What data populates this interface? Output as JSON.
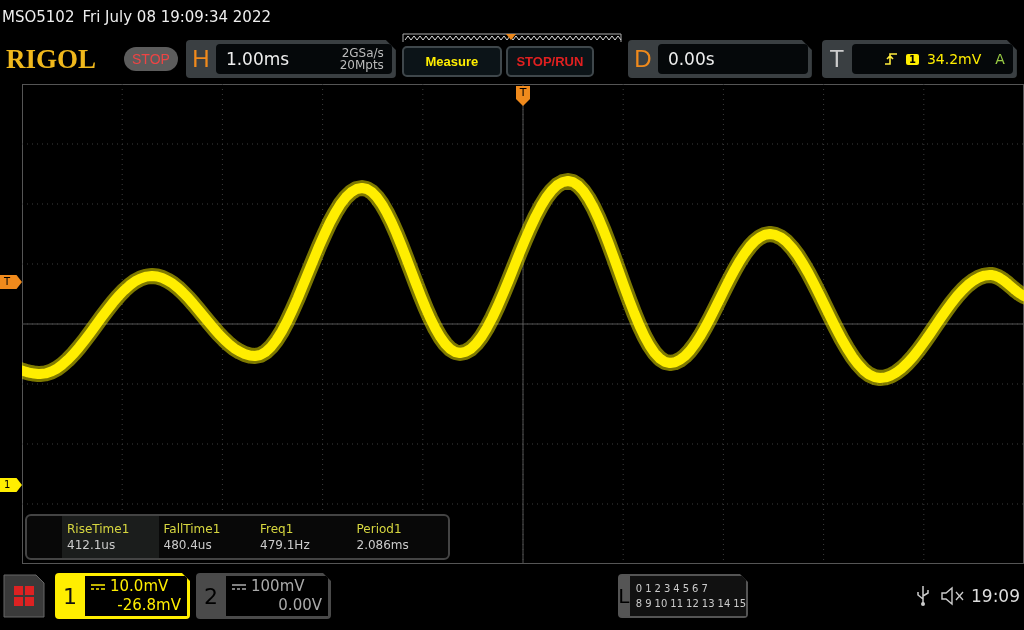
{
  "title_bar": {
    "model": "MSO5102",
    "datetime": "Fri July 08 19:09:34 2022"
  },
  "header": {
    "logo": "RIGOL",
    "run_state": "STOP",
    "horizontal": {
      "label": "H",
      "timebase": "1.00ms",
      "sample_rate": "2GSa/s",
      "memory_depth": "20Mpts"
    },
    "buttons": [
      "Measure",
      "STOP/RUN"
    ],
    "delay": {
      "label": "D",
      "value": "0.00s"
    },
    "trigger": {
      "label": "T",
      "source": "1",
      "level": "34.2mV",
      "mode": "A"
    }
  },
  "grid": {
    "trigger_position_marker": "T",
    "trigger_level_marker": "T",
    "channel_marker": "1"
  },
  "measurements": [
    {
      "name": "RiseTime1",
      "value": "412.1us",
      "selected": true
    },
    {
      "name": "FallTime1",
      "value": "480.4us",
      "selected": false
    },
    {
      "name": "Freq1",
      "value": "479.1Hz",
      "selected": false
    },
    {
      "name": "Period1",
      "value": "2.086ms",
      "selected": false
    }
  ],
  "channels": [
    {
      "number": "1",
      "scale": "10.0mV",
      "offset": "-26.8mV",
      "active": true
    },
    {
      "number": "2",
      "scale": "100mV",
      "offset": "0.00V",
      "active": false
    }
  ],
  "logic": {
    "label": "L",
    "row_1": [
      "0",
      "1",
      "2",
      "3",
      "4",
      "5",
      "6",
      "7"
    ],
    "row_2": [
      "8",
      "9",
      "10",
      "11",
      "12",
      "13",
      "14",
      "15"
    ]
  },
  "status": {
    "time": "19:09"
  }
}
